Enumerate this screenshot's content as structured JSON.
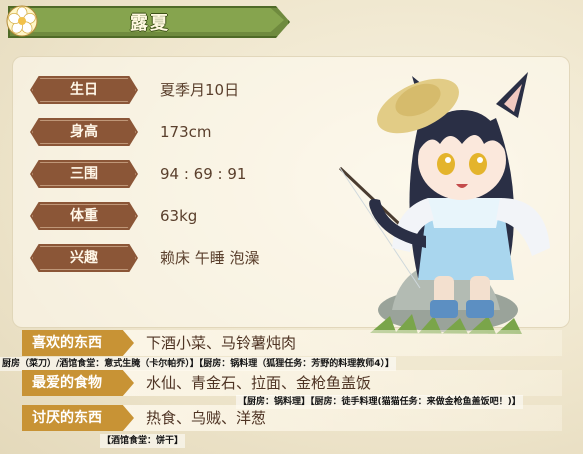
{
  "header": {
    "title": "露夏"
  },
  "profile": {
    "rows": [
      {
        "label": "生日",
        "value": "夏季月10日"
      },
      {
        "label": "身高",
        "value": "173cm"
      },
      {
        "label": "三围",
        "value": "94 : 69 : 91"
      },
      {
        "label": "体重",
        "value": "63kg"
      },
      {
        "label": "兴趣",
        "value": "赖床 午睡 泡澡"
      }
    ]
  },
  "preferences": {
    "likes": {
      "label": "喜欢的东西",
      "value": "下酒小菜、马铃薯炖肉"
    },
    "loves": {
      "label": "最爱的食物",
      "value": "水仙、青金石、拉面、金枪鱼盖饭"
    },
    "hates": {
      "label": "讨厌的东西",
      "value": "热食、乌贼、洋葱"
    }
  },
  "notes": {
    "likes_note": "厨房（菜刀）/酒馆食堂：意式生腌（卡尔帕乔）】【厨房：锅料理（狐狸任务：芳野的料理教师4）】",
    "loves_note": "【厨房：锅料理】【厨房：徒手料理(猫猫任务：来做金枪鱼盖饭吧！)】",
    "hates_note": "【酒馆食堂：饼干】"
  },
  "colors": {
    "header_green": "#86a44e",
    "label_brown": "#8b5637",
    "pref_gold": "#c89335",
    "text_brown": "#5a3f2c"
  },
  "icons": {
    "header_icon": "flower-icon"
  }
}
